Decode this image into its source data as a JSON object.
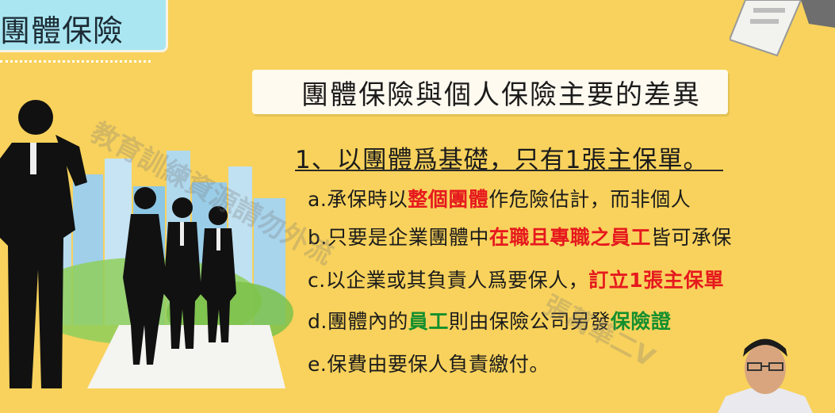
{
  "slide": {
    "title": "團體保險",
    "heading": "團體保險與個人保險主要的差異",
    "point1": "1、以團體爲基礎，只有1張主保單。",
    "items": [
      {
        "plain1": "a.承保時以",
        "hl": "整個團體",
        "plain2": "作危險估計，而非個人"
      },
      {
        "plain1": "b.只要是企業團體中",
        "hl": "在職且專職之員工",
        "plain2": "皆可承保"
      },
      {
        "plain1": "c.以企業或其負責人爲要保人，",
        "hl": "訂立1張主保單",
        "plain2": ""
      },
      {
        "plain1": "d.團體內的",
        "hl": "員工",
        "plain2": "則由保險公司另發",
        "hl2": "保險證"
      },
      {
        "plain1": "e.保費由要保人負責繳付。"
      }
    ]
  },
  "watermark": {
    "line1": "教育訓練資源請勿外流",
    "line2": "張萬華二V"
  },
  "colors": {
    "background": "#f8d25c",
    "title_box": "#a9e6f2",
    "highlight_red": "#e6191e",
    "highlight_green": "#138f2e"
  }
}
